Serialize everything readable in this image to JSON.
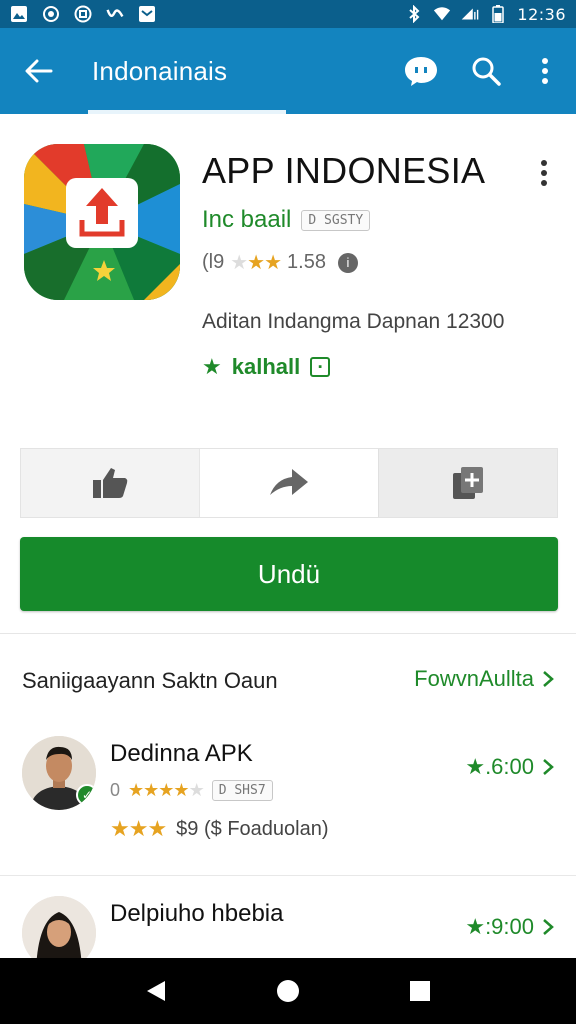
{
  "status_bar": {
    "time": "12:36",
    "icons": [
      "image-icon",
      "sync-icon",
      "data-icon",
      "vpn-icon",
      "notification-icon",
      "bluetooth-icon",
      "wifi-icon",
      "signal-icon",
      "battery-icon"
    ]
  },
  "app_bar": {
    "title": "Indonainais",
    "icons": [
      "back-arrow-icon",
      "chat-icon",
      "search-icon",
      "more-vert-icon"
    ],
    "color": "#1384bf",
    "status_color": "#0b5f8c"
  },
  "app": {
    "title": "APP INDONESIA",
    "developer": "Inc baail",
    "developer_tag": "D SGSTY",
    "rating_prefix": "(l9",
    "rating_value": "1.58",
    "description": "Aditan Indangma Dapnan 12300",
    "badge_label": "kalhall",
    "accent_color": "#1f8a2a"
  },
  "actions": {
    "icons": [
      "thumbs-up-icon",
      "share-icon",
      "bookmark-add-icon"
    ]
  },
  "install": {
    "label": "Undü",
    "color": "#168a2b"
  },
  "section": {
    "heading": "Saniigaayann Saktn Oaun",
    "link": "FowvnAullta",
    "items": [
      {
        "name": "Dedinna APK",
        "rating_prefix": "0",
        "tag": "D SHS7",
        "meta": "$9 ($ Foaduolan)",
        "price": "★.6:00"
      },
      {
        "name": "Delpiuho hbebia",
        "rating_prefix": "",
        "tag": "",
        "meta": "",
        "price": "★:9:00"
      }
    ]
  },
  "nav_bar": {
    "icons": [
      "back-triangle-icon",
      "home-circle-icon",
      "recents-square-icon"
    ]
  }
}
